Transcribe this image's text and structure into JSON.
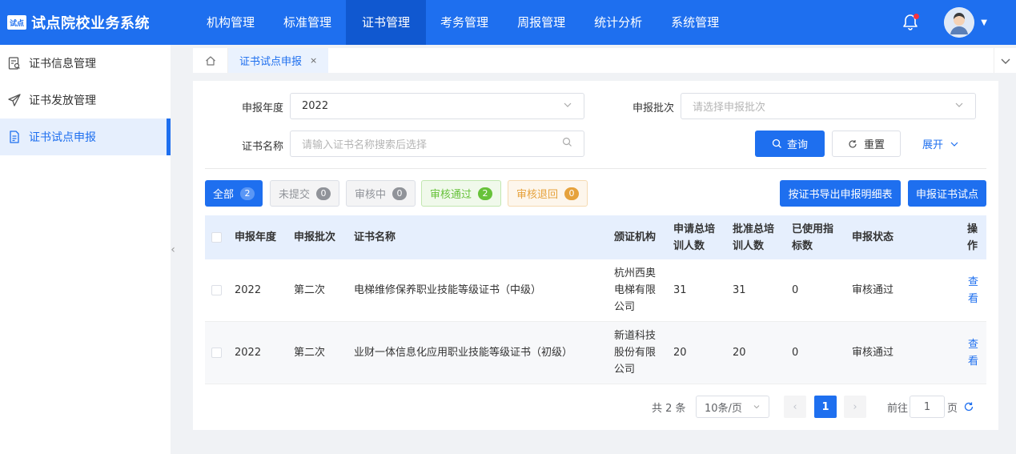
{
  "header": {
    "logo_badge": "试点",
    "title": "试点院校业务系统",
    "nav": [
      "机构管理",
      "标准管理",
      "证书管理",
      "考务管理",
      "周报管理",
      "统计分析",
      "系统管理"
    ],
    "active_nav": "证书管理"
  },
  "sidebar": {
    "items": [
      {
        "label": "证书信息管理",
        "icon": "doc-search-icon"
      },
      {
        "label": "证书发放管理",
        "icon": "send-icon"
      },
      {
        "label": "证书试点申报",
        "icon": "document-icon"
      }
    ],
    "active_index": 2
  },
  "tabs": {
    "open": [
      "证书试点申报"
    ],
    "close_glyph": "×"
  },
  "form": {
    "year_label": "申报年度",
    "year_value": "2022",
    "batch_label": "申报批次",
    "batch_placeholder": "请选择申报批次",
    "cert_label": "证书名称",
    "cert_placeholder": "请输入证书名称搜索后选择",
    "query_btn": "查询",
    "reset_btn": "重置",
    "expand_btn": "展开"
  },
  "filters": [
    {
      "label": "全部",
      "count": "2"
    },
    {
      "label": "未提交",
      "count": "0"
    },
    {
      "label": "审核中",
      "count": "0"
    },
    {
      "label": "审核通过",
      "count": "2"
    },
    {
      "label": "审核退回",
      "count": "0"
    }
  ],
  "actions": {
    "export_btn": "按证书导出申报明细表",
    "apply_btn": "申报证书试点"
  },
  "table": {
    "headers": {
      "year": "申报年度",
      "batch": "申报批次",
      "cert": "证书名称",
      "org": "颁证机构",
      "apply_1": "申请总培",
      "apply_2": "训人数",
      "approve_1": "批准总培",
      "approve_2": "训人数",
      "used_1": "已使用指",
      "used_2": "标数",
      "status": "申报状态",
      "op": "操作"
    },
    "rows": [
      {
        "year": "2022",
        "batch": "第二次",
        "cert": "电梯维修保养职业技能等级证书（中级）",
        "org_1": "杭州西奥",
        "org_2": "电梯有限",
        "org_3": "公司",
        "apply": "31",
        "approve": "31",
        "used": "0",
        "status": "审核通过",
        "op": "查看"
      },
      {
        "year": "2022",
        "batch": "第二次",
        "cert": "业财一体信息化应用职业技能等级证书（初级）",
        "org_1": "新道科技",
        "org_2": "股份有限",
        "org_3": "公司",
        "apply": "20",
        "approve": "20",
        "used": "0",
        "status": "审核通过",
        "op": "查看"
      }
    ]
  },
  "pagination": {
    "total": "共 2 条",
    "page_size": "10条/页",
    "current_page": "1",
    "goto_label": "前往",
    "goto_value": "1",
    "page_unit": "页"
  },
  "colors": {
    "primary": "#1e6fef",
    "pass": "#67c23a",
    "back": "#e6a23c"
  }
}
